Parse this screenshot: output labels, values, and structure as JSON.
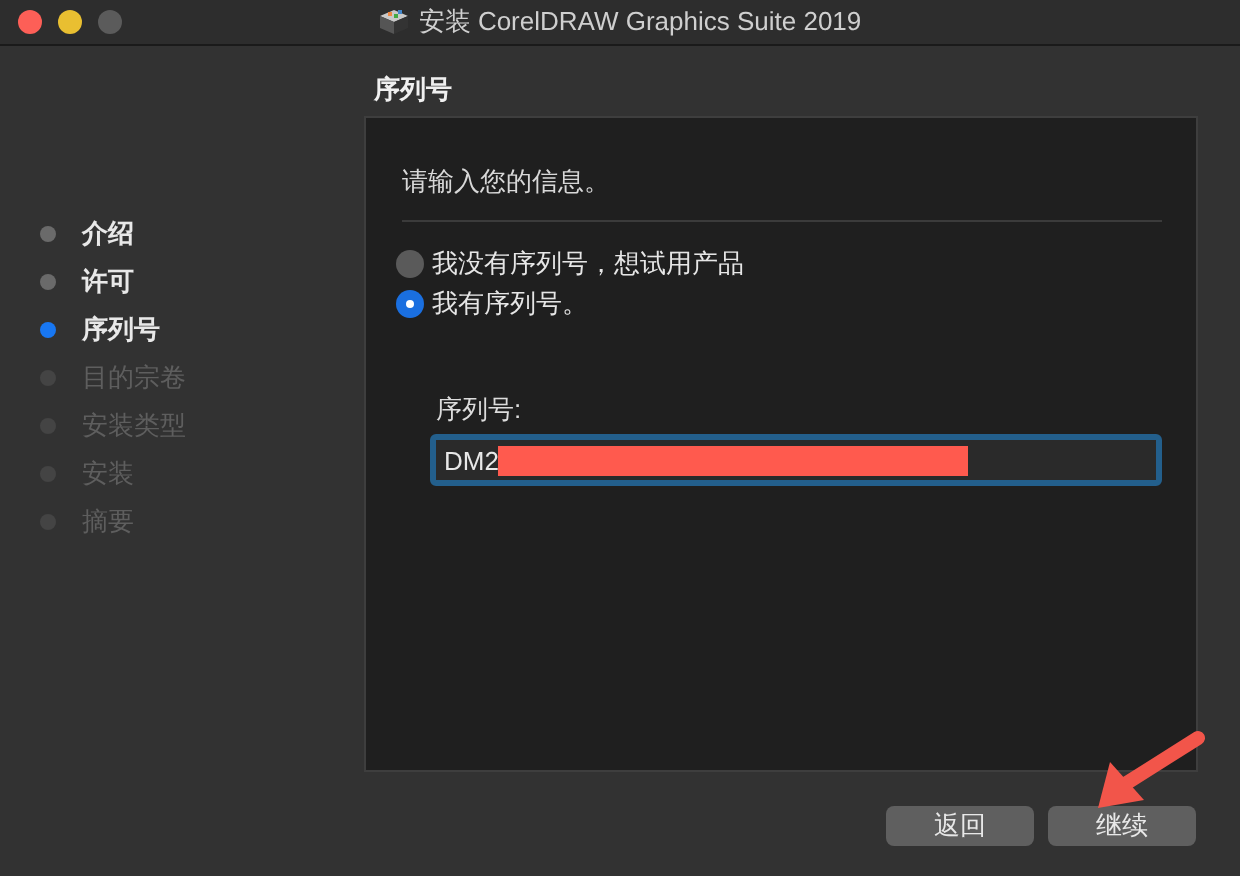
{
  "window": {
    "title": "安装 CorelDRAW Graphics Suite 2019"
  },
  "page_title": "序列号",
  "sidebar": {
    "items": [
      {
        "label": "介绍",
        "selected": false,
        "disabled": false
      },
      {
        "label": "许可",
        "selected": false,
        "disabled": false
      },
      {
        "label": "序列号",
        "selected": true,
        "disabled": false
      },
      {
        "label": "目的宗卷",
        "selected": false,
        "disabled": true
      },
      {
        "label": "安装类型",
        "selected": false,
        "disabled": true
      },
      {
        "label": "安装",
        "selected": false,
        "disabled": true
      },
      {
        "label": "摘要",
        "selected": false,
        "disabled": true
      }
    ]
  },
  "panel": {
    "prompt": "请输入您的信息。",
    "options": [
      {
        "label": "我没有序列号，想试用产品",
        "selected": false
      },
      {
        "label": "我有序列号。",
        "selected": true
      }
    ],
    "serial_field": {
      "label": "序列号:",
      "value": "DM2"
    }
  },
  "buttons": [
    "返回",
    "继续"
  ]
}
